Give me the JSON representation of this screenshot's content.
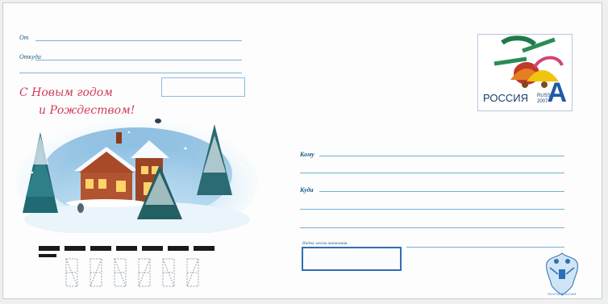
{
  "envelope": {
    "sender": {
      "from_label": "От",
      "from_address_label": "Откуда"
    },
    "greeting": {
      "line1": "С Новым годом",
      "line2": "и Рождеством!"
    },
    "stamp": {
      "country": "РОССИЯ",
      "country_latin": "RUSSIA",
      "year": "2007",
      "tariff_letter": "А"
    },
    "recipient": {
      "to_label": "Кому",
      "where_label": "Куда"
    },
    "postcode": {
      "label": "Индекс места назначения"
    },
    "publisher": {
      "caption": "ПОЧТА РОССИИ"
    }
  },
  "colors": {
    "line_blue": "#6fb2d8",
    "greeting_red": "#d13b5f",
    "stamp_blue": "#1e5aa8",
    "postcode_frame": "#2f6fb0"
  }
}
